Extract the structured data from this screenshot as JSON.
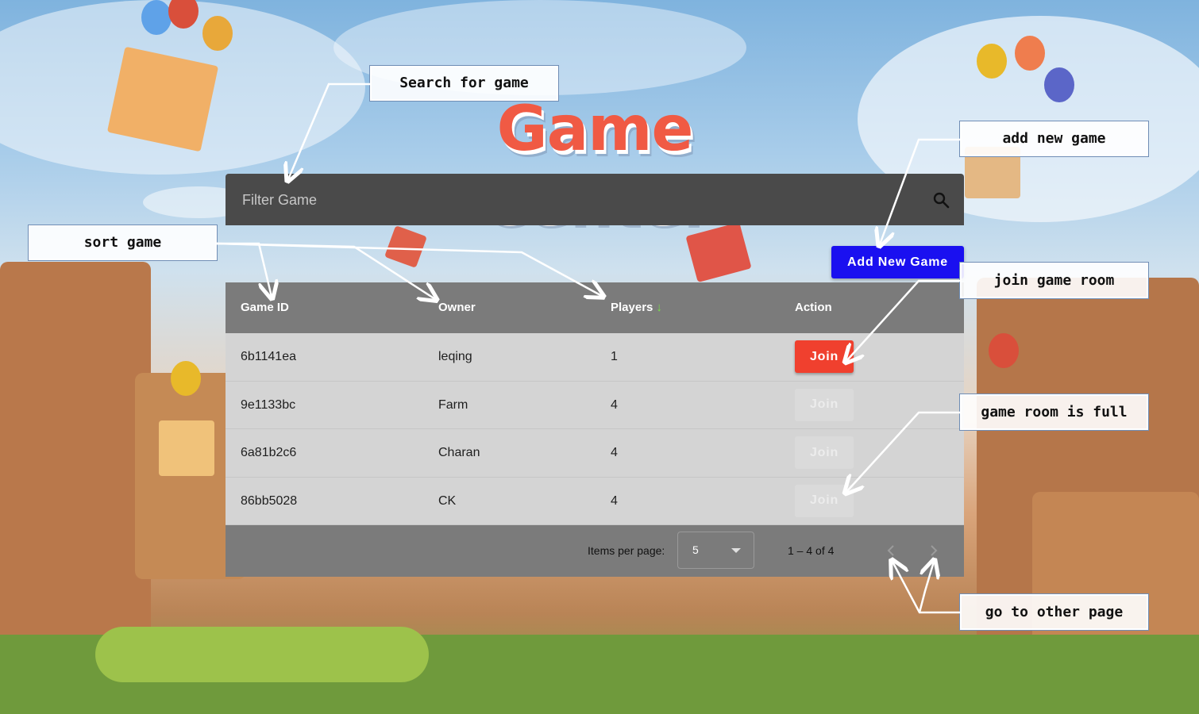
{
  "app": {
    "title": "Game Center"
  },
  "search": {
    "placeholder": "Filter Game"
  },
  "toolbar": {
    "add_label": "Add New Game"
  },
  "table": {
    "columns": [
      "Game ID",
      "Owner",
      "Players",
      "Action"
    ],
    "sort": {
      "column": "Players",
      "direction": "descending",
      "indicator": "↓"
    },
    "rows": [
      {
        "game_id": "6b1141ea",
        "owner": "leqing",
        "players": "1",
        "action": "Join",
        "joinable": true
      },
      {
        "game_id": "9e1133bc",
        "owner": "Farm",
        "players": "4",
        "action": "Join",
        "joinable": false
      },
      {
        "game_id": "6a81b2c6",
        "owner": "Charan",
        "players": "4",
        "action": "Join",
        "joinable": false
      },
      {
        "game_id": "86bb5028",
        "owner": "CK",
        "players": "4",
        "action": "Join",
        "joinable": false
      }
    ]
  },
  "paginator": {
    "items_label": "Items per page:",
    "page_size": "5",
    "range": "1 – 4 of 4",
    "prev_icon": "chevron-left-icon",
    "next_icon": "chevron-right-icon"
  },
  "annotations": {
    "search": "Search for game",
    "add": "add new game",
    "sort": "sort game",
    "join": "join game room",
    "full": "game room is full",
    "page": "go to other page"
  },
  "colors": {
    "title": "#f05a44",
    "add_button": "#1a10f0",
    "join_button": "#f0402e",
    "header_bg": "#7b7b7b",
    "row_bg": "#d4d4d4",
    "search_bg": "#4a4a4a",
    "sort_arrow": "#7be04a"
  }
}
